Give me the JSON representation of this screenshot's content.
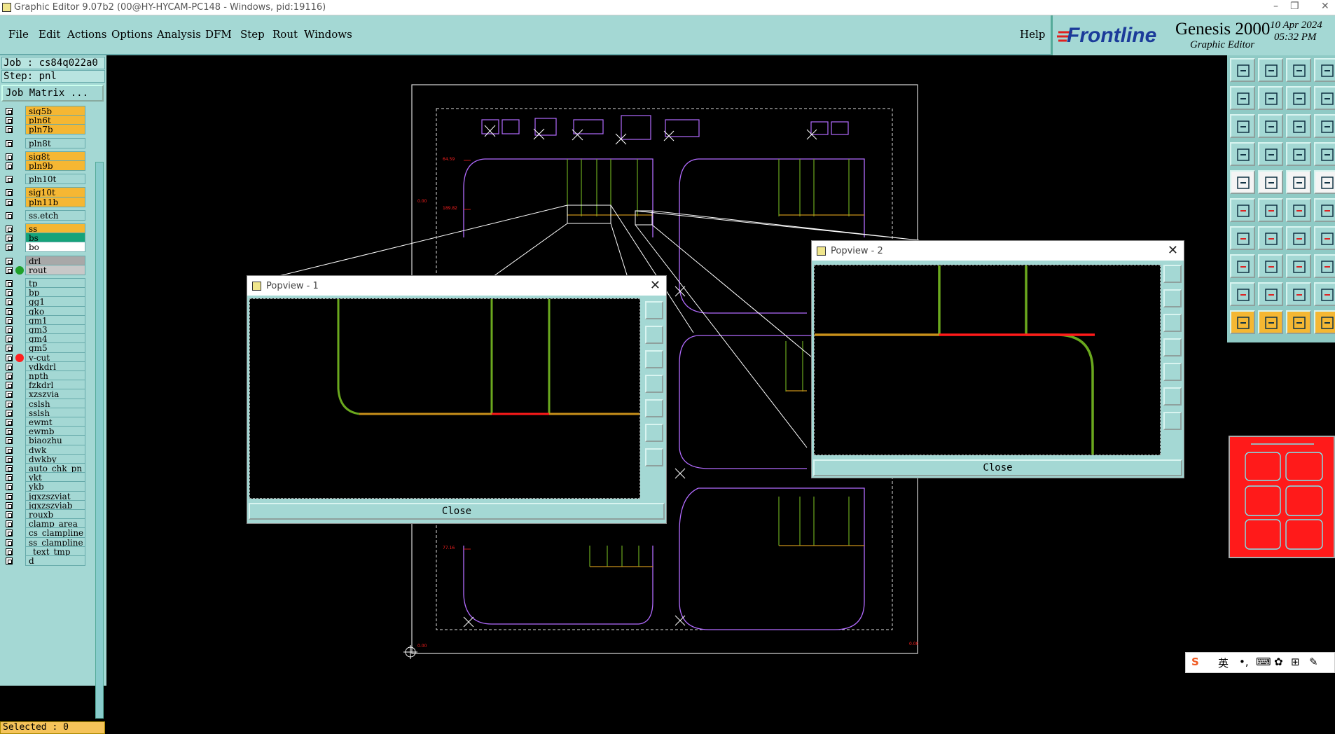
{
  "window": {
    "title": "Graphic Editor 9.07b2 (00@HY-HYCAM-PC148 - Windows, pid:19116)"
  },
  "menu": {
    "items": [
      "File",
      "Edit",
      "Actions",
      "Options",
      "Analysis",
      "DFM",
      "Step",
      "Rout",
      "Windows"
    ],
    "help": "Help"
  },
  "brand": {
    "logo": "Frontline",
    "product": "Genesis 2000",
    "subtitle": "Graphic Editor",
    "date": "10 Apr 2024",
    "time": "05:32 PM"
  },
  "job": {
    "job_label": "Job : cs84q022a0",
    "step_label": "Step: pnl",
    "matrix_button": "Job Matrix ..."
  },
  "layers": [
    {
      "name": "sig5b",
      "color": "#f5b733"
    },
    {
      "name": "pln6t",
      "color": "#f5b733"
    },
    {
      "name": "pln7b",
      "color": "#f5b733"
    },
    {
      "name": "pln8t",
      "color": "#a4d8d4"
    },
    {
      "name": "sig8t",
      "color": "#f5b733"
    },
    {
      "name": "pln9b",
      "color": "#f5b733"
    },
    {
      "name": "pln10t",
      "color": "#a4d8d4"
    },
    {
      "name": "sig10t",
      "color": "#f5b733"
    },
    {
      "name": "pln11b",
      "color": "#f5b733"
    },
    {
      "name": "ss.etch",
      "color": "#a4d8d4"
    },
    {
      "name": "ss",
      "color": "#f5b733"
    },
    {
      "name": "bs",
      "color": "#16a37a"
    },
    {
      "name": "bo",
      "color": "#ffffff"
    },
    {
      "name": "drl",
      "color": "#a8a8a8"
    },
    {
      "name": "rout",
      "color": "#c8c8c8"
    },
    {
      "name": "tp",
      "color": "#a4d8d4"
    },
    {
      "name": "bp",
      "color": "#a4d8d4"
    },
    {
      "name": "gg1",
      "color": "#a4d8d4"
    },
    {
      "name": "gko",
      "color": "#a4d8d4"
    },
    {
      "name": "gm1",
      "color": "#a4d8d4"
    },
    {
      "name": "gm3",
      "color": "#a4d8d4"
    },
    {
      "name": "gm4",
      "color": "#a4d8d4"
    },
    {
      "name": "gm5",
      "color": "#a4d8d4"
    },
    {
      "name": "v-cut",
      "color": "#a4d8d4"
    },
    {
      "name": "ydkdrl",
      "color": "#a4d8d4"
    },
    {
      "name": "npth",
      "color": "#a4d8d4"
    },
    {
      "name": "fzkdrl",
      "color": "#a4d8d4"
    },
    {
      "name": "xzszvia",
      "color": "#a4d8d4"
    },
    {
      "name": "cslsh",
      "color": "#a4d8d4"
    },
    {
      "name": "sslsh",
      "color": "#a4d8d4"
    },
    {
      "name": "ewmt",
      "color": "#a4d8d4"
    },
    {
      "name": "ewmb",
      "color": "#a4d8d4"
    },
    {
      "name": "biaozhu",
      "color": "#a4d8d4"
    },
    {
      "name": "dwk",
      "color": "#a4d8d4"
    },
    {
      "name": "dwkby",
      "color": "#a4d8d4"
    },
    {
      "name": "auto_chk_pn",
      "color": "#a4d8d4"
    },
    {
      "name": "ykt",
      "color": "#a4d8d4"
    },
    {
      "name": "ykb",
      "color": "#a4d8d4"
    },
    {
      "name": "jgxzszviat",
      "color": "#a4d8d4"
    },
    {
      "name": "jgxzszviab",
      "color": "#a4d8d4"
    },
    {
      "name": "rouxb",
      "color": "#a4d8d4"
    },
    {
      "name": "clamp_area",
      "color": "#a4d8d4"
    },
    {
      "name": "cs_clampline",
      "color": "#a4d8d4"
    },
    {
      "name": "ss_clampline",
      "color": "#a4d8d4"
    },
    {
      "name": "_text_tmp",
      "color": "#a4d8d4"
    },
    {
      "name": "d",
      "color": "#a4d8d4"
    }
  ],
  "status": {
    "selected": "Selected : 0"
  },
  "dims": {
    "d1": "64.59",
    "d2": "189.82",
    "d3": "77.16",
    "d4": "0.00",
    "d5": "0.00",
    "d6": "0.00"
  },
  "popview1": {
    "title": "Popview - 1",
    "close": "Close"
  },
  "popview2": {
    "title": "Popview - 2",
    "close": "Close"
  },
  "ime": {
    "lang": "英"
  },
  "colors": {
    "panel": "#a4d8d4",
    "outline": "#b26bff",
    "trace_green": "#6aa81e",
    "trace_orange": "#c8901a",
    "trace_red": "#ff1a1a"
  }
}
